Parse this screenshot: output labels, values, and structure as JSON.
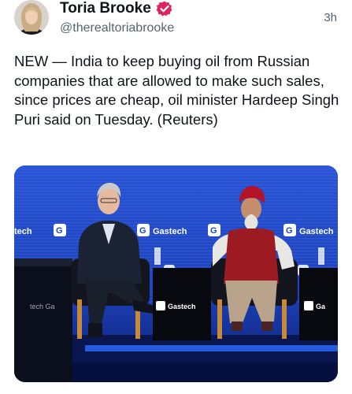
{
  "author": {
    "display_name": "Toria Brooke",
    "handle": "@therealtoriabrooke",
    "verified_icon": "verified-badge-icon",
    "verified_color": "#e0245e"
  },
  "timestamp": "3h",
  "tweet": {
    "text": "NEW — India to keep buying oil from Russian companies that are allowed to make such sales, since prices are cheap, oil minister Hardeep Singh Puri said on Tuesday. (Reuters)"
  },
  "media": {
    "backdrop_texts": [
      "tech",
      "Gastech",
      "Gastech",
      "Gastech",
      "Gastech",
      "Gastech"
    ],
    "sign_text": "Gastech",
    "accent_color": "#1b44c8"
  }
}
